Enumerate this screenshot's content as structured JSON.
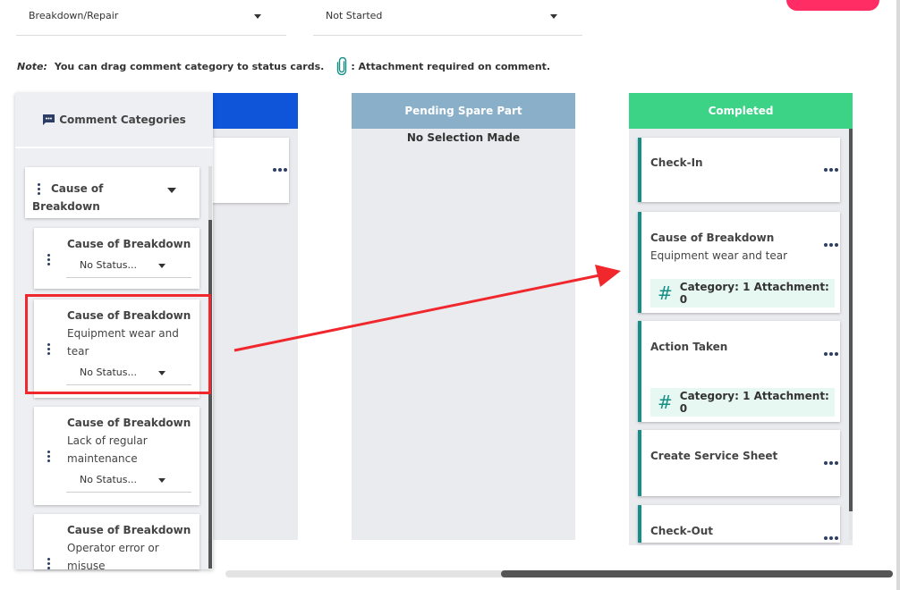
{
  "filters": {
    "type_value": "Breakdown/Repair",
    "status_value": "Not Started"
  },
  "note": {
    "label": "Note:",
    "drag_text": "You can drag comment category to status cards.",
    "attachment_text": ": Attachment required on comment."
  },
  "categories": {
    "header": "Comment Categories",
    "group_label": "Cause of Breakdown",
    "items": [
      {
        "title": "Cause of Breakdown",
        "desc": "",
        "status": "No Status..."
      },
      {
        "title": "Cause of Breakdown",
        "desc": "Equipment wear and tear",
        "status": "No Status..."
      },
      {
        "title": "Cause of Breakdown",
        "desc": "Lack of regular maintenance",
        "status": "No Status..."
      },
      {
        "title": "Cause of Breakdown",
        "desc": "Operator error or misuse",
        "status": ""
      }
    ]
  },
  "columns": {
    "pending": {
      "title": "Pending Spare Part",
      "empty": "No Selection Made"
    },
    "completed": {
      "title": "Completed",
      "cards": [
        {
          "title": "Check-In",
          "desc": "",
          "tag": ""
        },
        {
          "title": "Cause of Breakdown",
          "desc": "Equipment wear and tear",
          "tag": "Category: 1 Attachment: 0"
        },
        {
          "title": "Action Taken",
          "desc": "",
          "tag": "Category: 1 Attachment: 0"
        },
        {
          "title": "Create Service Sheet",
          "desc": "",
          "tag": ""
        },
        {
          "title": "Check-Out",
          "desc": "",
          "tag": ""
        }
      ]
    }
  },
  "colors": {
    "blue_header": "#0f55d9",
    "pending_header": "#8aafc9",
    "completed_header": "#3cd387",
    "accent_teal": "#158f86",
    "highlight_red": "#f0282d",
    "button_pink": "#ff2d64"
  },
  "icons": {
    "chat": "chat-bubble-icon",
    "clip": "paperclip-icon",
    "hash": "hashtag-icon",
    "more": "more-horizontal-icon",
    "drag": "more-vertical-icon"
  }
}
